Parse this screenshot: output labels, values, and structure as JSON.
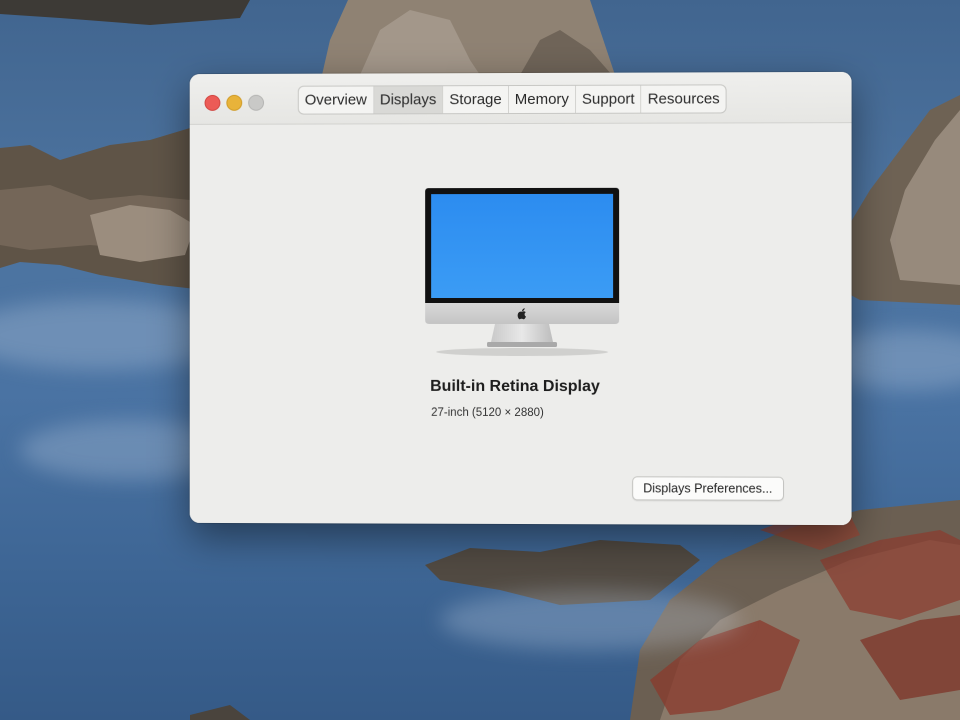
{
  "window": {
    "tabs": [
      {
        "label": "Overview"
      },
      {
        "label": "Displays"
      },
      {
        "label": "Storage"
      },
      {
        "label": "Memory"
      },
      {
        "label": "Support"
      },
      {
        "label": "Resources"
      }
    ],
    "active_tab": "Displays"
  },
  "display": {
    "name": "Built-in Retina Display",
    "spec": "27-inch (5120 × 2880)",
    "screen_color": "#2f8ff0"
  },
  "actions": {
    "preferences_label": "Displays Preferences..."
  },
  "icons": {
    "traffic_lights": [
      "close-icon",
      "minimize-icon",
      "zoom-icon"
    ],
    "logo": "apple-logo-icon"
  },
  "colors": {
    "close": "#ec5b56",
    "minimize": "#e8b33a",
    "zoom_disabled": "#c9c9c7"
  }
}
